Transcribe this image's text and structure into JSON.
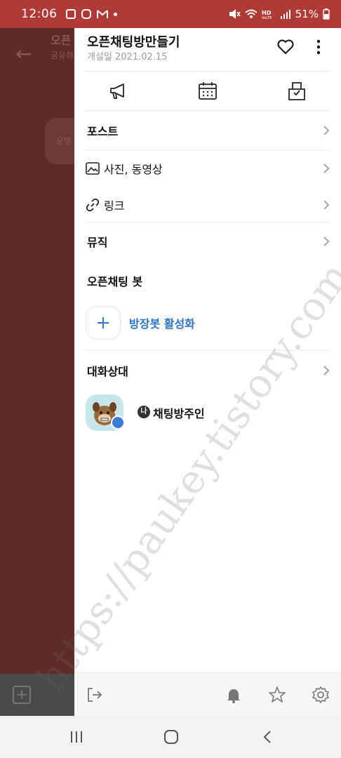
{
  "status_bar": {
    "time": "12:06",
    "battery": "51%"
  },
  "background_chat": {
    "title": "오픈",
    "subtitle": "공유하",
    "bubble": "운영"
  },
  "drawer": {
    "title": "오픈채팅방만들기",
    "date": "개설일 2021.02.15",
    "icons": [
      "megaphone-icon",
      "calendar-icon",
      "ballot-box-icon"
    ],
    "menu": [
      {
        "label": "포스트",
        "bold": true
      },
      {
        "label": "사진, 동영상",
        "icon": "image-icon"
      },
      {
        "label": "링크",
        "icon": "link-icon"
      },
      {
        "label": "뮤직",
        "bold": true
      }
    ],
    "bot_section_title": "오픈채팅 봇",
    "bot_action": "방장봇 활성화",
    "members_title": "대화상대",
    "member": {
      "badge": "나",
      "name": "채팅방주인"
    }
  },
  "footer_icons": [
    "exit-icon",
    "bell-icon",
    "star-icon",
    "settings-icon"
  ],
  "nav": [
    "recent-apps-icon",
    "home-icon",
    "back-icon"
  ],
  "watermark": "https://paukey.tistory.com",
  "colors": {
    "status_bar": "#b03a35",
    "accent_blue": "#2a74c9",
    "dim_bg": "#5e2b28"
  }
}
